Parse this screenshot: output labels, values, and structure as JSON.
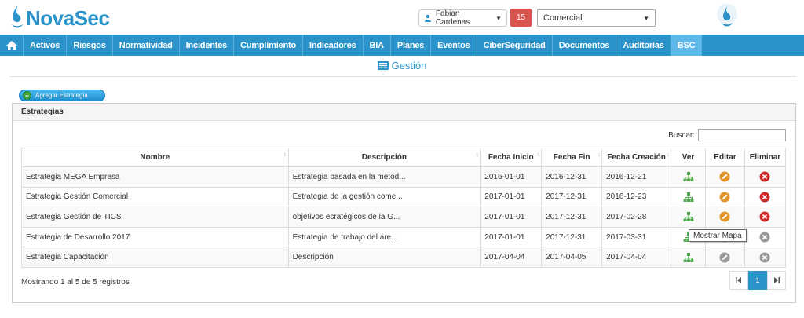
{
  "brand": {
    "name": "NovaSec"
  },
  "user": {
    "name": "Fabian Cardenas"
  },
  "notifications": {
    "count": "15"
  },
  "area_select": {
    "value": "Comercial"
  },
  "nav": {
    "items": [
      "Activos",
      "Riesgos",
      "Normatividad",
      "Incidentes",
      "Cumplimiento",
      "Indicadores",
      "BIA",
      "Planes",
      "Eventos",
      "CiberSeguridad",
      "Documentos",
      "Auditorías",
      "BSC"
    ],
    "active": "BSC"
  },
  "page": {
    "title": "Gestión"
  },
  "actions": {
    "add_label": "Agregar Estrategia"
  },
  "panel": {
    "title": "Estrategias"
  },
  "search": {
    "label": "Buscar:",
    "value": ""
  },
  "table": {
    "headers": [
      "Nombre",
      "Descripción",
      "Fecha Inicio",
      "Fecha Fin",
      "Fecha Creación",
      "Ver",
      "Editar",
      "Eliminar"
    ],
    "rows": [
      {
        "nombre": "Estrategia MEGA Empresa",
        "descripcion": "Estrategia basada en la metod...",
        "inicio": "2016-01-01",
        "fin": "2016-12-31",
        "creacion": "2016-12-21",
        "editable": true
      },
      {
        "nombre": "Estrategia Gestión Comercial",
        "descripcion": "Estrategia de la gestión come...",
        "inicio": "2017-01-01",
        "fin": "2017-12-31",
        "creacion": "2016-12-23",
        "editable": true
      },
      {
        "nombre": "Estrategia Gestión de TICS",
        "descripcion": "objetivos esratégicos de la G...",
        "inicio": "2017-01-01",
        "fin": "2017-12-31",
        "creacion": "2017-02-28",
        "editable": true
      },
      {
        "nombre": "Estrategia de Desarrollo 2017",
        "descripcion": "Estrategia de trabajo del áre...",
        "inicio": "2017-01-01",
        "fin": "2017-12-31",
        "creacion": "2017-03-31",
        "editable": false
      },
      {
        "nombre": "Estrategia Capacitación",
        "descripcion": "Descripción",
        "inicio": "2017-04-04",
        "fin": "2017-04-05",
        "creacion": "2017-04-04",
        "editable": false
      }
    ]
  },
  "footer": {
    "info": "Mostrando 1 al 5 de 5 registros",
    "page": "1"
  },
  "tooltip": {
    "text": "Mostrar Mapa"
  },
  "icons": {
    "ver": "sitemap-icon",
    "editar": "pencil-icon",
    "eliminar": "delete-icon"
  },
  "colors": {
    "brand": "#2a93c9",
    "danger": "#cc2b2b",
    "edit": "#e0942a",
    "view": "#4ca64c",
    "disabled": "#999999"
  }
}
